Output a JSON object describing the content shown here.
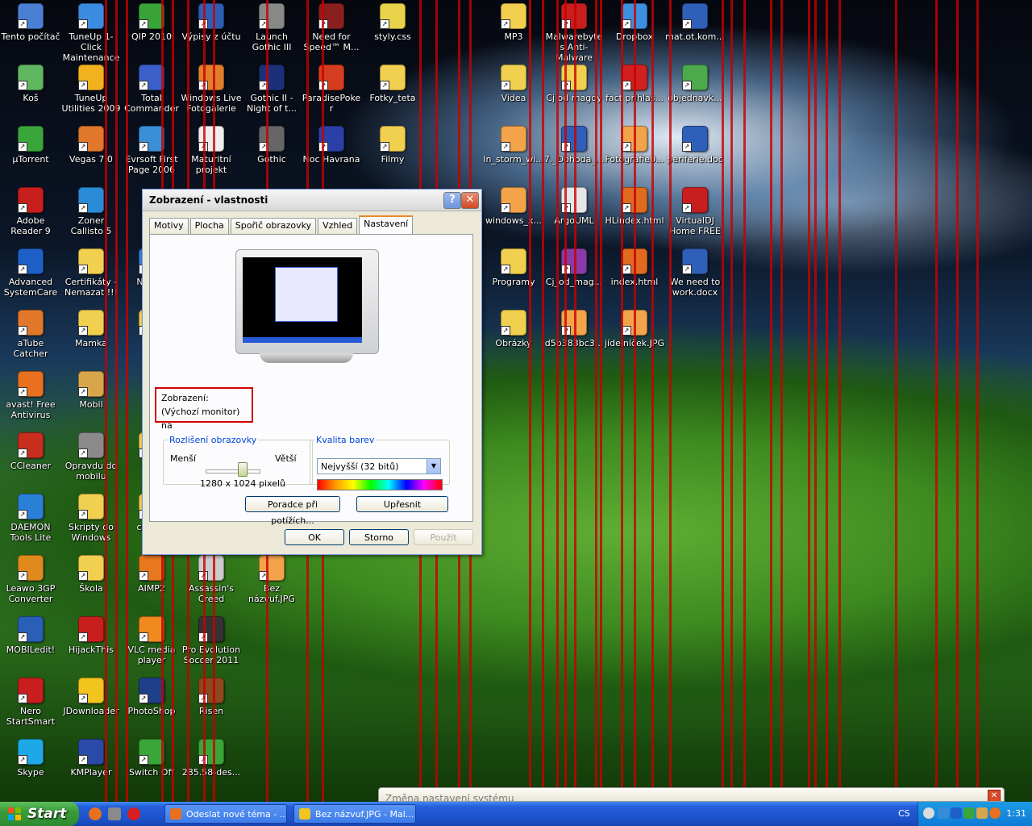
{
  "desktop": {
    "icons": [
      {
        "label": "Tento počítač",
        "color": "#4a7fd4"
      },
      {
        "label": "TuneUp 1-Click Maintenance",
        "color": "#3b8ce0"
      },
      {
        "label": "QIP 2010",
        "color": "#39a339"
      },
      {
        "label": "Výpisy z účtu",
        "color": "#2b5fb5"
      },
      {
        "label": "Launch Gothic III",
        "color": "#888888"
      },
      {
        "label": "Need for Speed™ M...",
        "color": "#8a1f1f"
      },
      {
        "label": "styly.css",
        "color": "#e8d24a"
      },
      {
        "label": "MP3",
        "color": "#f1cf4f"
      },
      {
        "label": "Malwarebytes Anti-Malware",
        "color": "#c91e1e"
      },
      {
        "label": "Dropbox",
        "color": "#3d8fe0"
      },
      {
        "label": "mat.ot.kom...",
        "color": "#2f5fb8"
      },
      {
        "label": "Koš",
        "color": "#5fb85f"
      },
      {
        "label": "TuneUp Utilities 2009",
        "color": "#f2b21e"
      },
      {
        "label": "Total Commander",
        "color": "#3b5fc8"
      },
      {
        "label": "Windows Live Fotogalerie",
        "color": "#e07e2a"
      },
      {
        "label": "Gothic II - Night of t...",
        "color": "#1c2f7a"
      },
      {
        "label": "ParadisePoker",
        "color": "#d63c1e"
      },
      {
        "label": "Fotky_teta",
        "color": "#f1cf4f"
      },
      {
        "label": "Videa",
        "color": "#f1cf4f"
      },
      {
        "label": "Cj od magdy",
        "color": "#f1cf4f"
      },
      {
        "label": "fact prihlas...",
        "color": "#d21f1f"
      },
      {
        "label": "objednavk...",
        "color": "#4caa4c"
      },
      {
        "label": "µTorrent",
        "color": "#3aa63a"
      },
      {
        "label": "Vegas 7.0",
        "color": "#e0772a"
      },
      {
        "label": "Evrsoft First Page 2006",
        "color": "#3a8fd6"
      },
      {
        "label": "Maturitní projekt",
        "color": "#eeeeee"
      },
      {
        "label": "Gothic",
        "color": "#666666"
      },
      {
        "label": "Noc Havrana",
        "color": "#2b3fa8"
      },
      {
        "label": "Filmy",
        "color": "#f1cf4f"
      },
      {
        "label": "In_storm_wi...",
        "color": "#f3a34a"
      },
      {
        "label": "7._Dohoda_...",
        "color": "#2f5fb8"
      },
      {
        "label": "Fotografie0...",
        "color": "#f3a34a"
      },
      {
        "label": "periferie.doc",
        "color": "#2f5fb8"
      },
      {
        "label": "Adobe Reader 9",
        "color": "#c81e1e"
      },
      {
        "label": "Zoner Callisto 5",
        "color": "#2a8bd6"
      },
      {
        "label": "windows_x...",
        "color": "#f3a34a"
      },
      {
        "label": "ArgoUML",
        "color": "#e6e6e6"
      },
      {
        "label": "HLindex.html",
        "color": "#e06a1e"
      },
      {
        "label": "VirtualDJ Home FREE",
        "color": "#c81e1e"
      },
      {
        "label": "Advanced SystemCare",
        "color": "#1e5fc8"
      },
      {
        "label": "Certifikáty - Nemazat !!!",
        "color": "#f1cf4f"
      },
      {
        "label": "NetB...",
        "color": "#3b7fd4"
      },
      {
        "label": "Programy",
        "color": "#f1cf4f"
      },
      {
        "label": "Cj_od_mag...",
        "color": "#8a3aa8"
      },
      {
        "label": "index.html",
        "color": "#e06a1e"
      },
      {
        "label": "We need to work.docx",
        "color": "#2f5fb8"
      },
      {
        "label": "aTube Catcher",
        "color": "#e0772a"
      },
      {
        "label": "Mamka",
        "color": "#f1cf4f"
      },
      {
        "label": "P...",
        "color": "#f1cf4f"
      },
      {
        "label": "Obrázky",
        "color": "#f1cf4f"
      },
      {
        "label": "d5b383bc3...",
        "color": "#f3a34a"
      },
      {
        "label": "jídelníček.JPG",
        "color": "#f3a34a"
      },
      {
        "label": "avast! Free Antivirus",
        "color": "#e8701e"
      },
      {
        "label": "Mobil",
        "color": "#d8a64a"
      },
      {
        "label": "CCleaner",
        "color": "#c82d1e"
      },
      {
        "label": "Opravdu do mobilu",
        "color": "#8a8a8a"
      },
      {
        "label": "Po...",
        "color": "#f1cf4f"
      },
      {
        "label": "DAEMON Tools Lite",
        "color": "#2a7fd6"
      },
      {
        "label": "Skripty do Windows",
        "color": "#f1cf4f"
      },
      {
        "label": "codp...",
        "color": "#f1cf4f"
      },
      {
        "label": "Leawo 3GP Converter",
        "color": "#e08a1e"
      },
      {
        "label": "Škola",
        "color": "#f1cf4f"
      },
      {
        "label": "AIMP2",
        "color": "#e8781e"
      },
      {
        "label": "Assassin's Creed",
        "color": "#cccccc"
      },
      {
        "label": "Bez názvuf.JPG",
        "color": "#f3a34a"
      },
      {
        "label": "MOBILedit!",
        "color": "#2a5fb8"
      },
      {
        "label": "HijackThis",
        "color": "#c81e1e"
      },
      {
        "label": "VLC media player",
        "color": "#f08a1e"
      },
      {
        "label": "Pro Evolution Soccer 2011",
        "color": "#333333"
      },
      {
        "label": "Nero StartSmart",
        "color": "#c81e1e"
      },
      {
        "label": "JDownloader",
        "color": "#f1c41e"
      },
      {
        "label": "PhotoShop",
        "color": "#1e3f8a"
      },
      {
        "label": "Risen",
        "color": "#8a4a1e"
      },
      {
        "label": "Skype",
        "color": "#1ea8e8"
      },
      {
        "label": "KMPlayer",
        "color": "#2a4aa8"
      },
      {
        "label": "Switch Off",
        "color": "#3aa63a"
      },
      {
        "label": "285.58-des...",
        "color": "#3aa63a"
      }
    ]
  },
  "dialog": {
    "title": "Zobrazení - vlastnosti",
    "help_btn": "?",
    "close_btn": "✕",
    "tabs": [
      "Motivy",
      "Plocha",
      "Spořič obrazovky",
      "Vzhled",
      "Nastavení"
    ],
    "display_label": "Zobrazení:",
    "display_value": "(Výchozí monitor) na",
    "resolution": {
      "legend": "Rozlišení obrazovky",
      "less": "Menší",
      "more": "Větší",
      "value": "1280 x 1024 pixelů"
    },
    "color": {
      "legend": "Kvalita barev",
      "selected": "Nejvyšší (32 bitů)"
    },
    "troubleshoot_btn": "Poradce při potížích...",
    "advanced_btn": "Upřesnit",
    "ok_btn": "OK",
    "cancel_btn": "Storno",
    "apply_btn": "Použít"
  },
  "notification": {
    "text": "Změna nastavení systému"
  },
  "taskbar": {
    "start": "Start",
    "tasks": [
      {
        "label": "Odeslat nové téma - ...",
        "color": "#e8701e"
      },
      {
        "label": "Bez názvuf.JPG - Mal...",
        "color": "#f1c41e"
      }
    ],
    "language": "CS",
    "clock": "1:31"
  },
  "colors": {
    "taskbar_blue": "#245edb",
    "start_green": "#3a9b3a",
    "highlight_red": "#d40000",
    "tab_accent": "#e68b2c",
    "legend_blue": "#0046d5"
  }
}
